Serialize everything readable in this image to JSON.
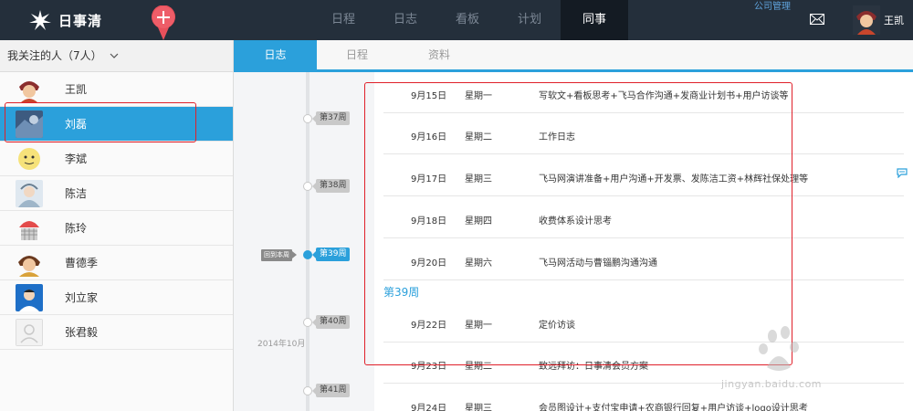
{
  "app": {
    "logo_text": "日事清",
    "company_link": "公司管理",
    "username": "王凯"
  },
  "nav": [
    {
      "label": "日程"
    },
    {
      "label": "日志"
    },
    {
      "label": "看板"
    },
    {
      "label": "计划"
    },
    {
      "label": "同事",
      "active": true
    }
  ],
  "left": {
    "header": "我关注的人（7人）",
    "people": [
      {
        "name": "王凯"
      },
      {
        "name": "刘磊",
        "active": true
      },
      {
        "name": "李斌"
      },
      {
        "name": "陈洁"
      },
      {
        "name": "陈玲"
      },
      {
        "name": "曹德季"
      },
      {
        "name": "刘立家"
      },
      {
        "name": "张君毅"
      }
    ]
  },
  "subtabs": [
    "日志",
    "日程",
    "资料"
  ],
  "timeline": {
    "weeks": [
      "第37周",
      "第38周",
      "第39周",
      "第40周",
      "第41周"
    ],
    "current_week": "第39周",
    "back_button": "回到本周",
    "month": "2014年10月"
  },
  "logs": [
    {
      "date": "9月15日",
      "weekday": "星期一",
      "content": "写软文+看板思考+飞马合作沟通+发商业计划书+用户访谈等"
    },
    {
      "date": "9月16日",
      "weekday": "星期二",
      "content": "工作日志"
    },
    {
      "date": "9月17日",
      "weekday": "星期三",
      "content": "飞马网演讲准备+用户沟通+开发票、发陈洁工资+林辉社保处理等",
      "has_comment": true
    },
    {
      "date": "9月18日",
      "weekday": "星期四",
      "content": "收费体系设计思考"
    },
    {
      "date": "9月20日",
      "weekday": "星期六",
      "content": "飞马网活动与曹锱鹏沟通沟通"
    },
    {
      "date": "9月22日",
      "weekday": "星期一",
      "content": "定价访谈"
    },
    {
      "date": "9月23日",
      "weekday": "星期二",
      "content": "致远拜访：日事清会员方案"
    },
    {
      "date": "9月24日",
      "weekday": "星期三",
      "content": "会员图设计+支付宝申请+农商银行回复+用户访谈+logo设计思考"
    }
  ],
  "week_separator": "第39周",
  "watermark": {
    "brand": "Baidu经验",
    "url": "jingyan.baidu.com"
  },
  "colors": {
    "topbar": "#242f3b",
    "accent": "#2ba0db",
    "highlight": "#e0202a"
  }
}
